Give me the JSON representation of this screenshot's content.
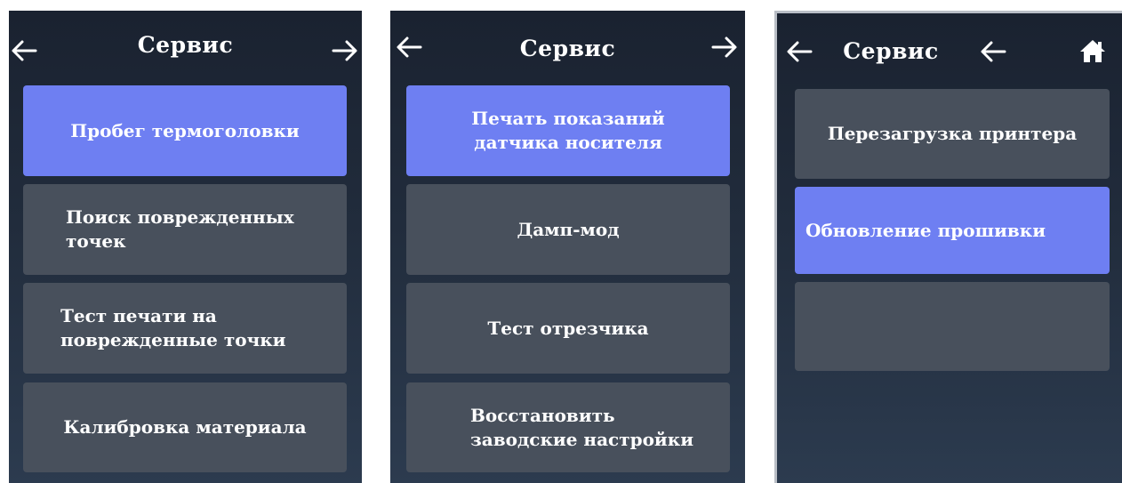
{
  "screens": [
    {
      "title": "Сервис",
      "items": [
        {
          "label": "Пробег термоголовки",
          "active": true
        },
        {
          "label": "Поиск поврежденных точек",
          "active": false
        },
        {
          "label": "Тест печати на поврежденные точки",
          "active": false
        },
        {
          "label": "Калибровка материала",
          "active": false
        }
      ]
    },
    {
      "title": "Сервис",
      "items": [
        {
          "label": "Печать показаний датчика носителя",
          "active": true
        },
        {
          "label": "Дамп-мод",
          "active": false
        },
        {
          "label": "Тест отрезчика",
          "active": false
        },
        {
          "label": "Восстановить заводские настройки",
          "active": false
        }
      ]
    },
    {
      "title": "Сервис",
      "items": [
        {
          "label": "Перезагрузка принтера",
          "active": false
        },
        {
          "label": "Обновление прошивки",
          "active": true
        },
        {
          "label": "",
          "active": false
        }
      ]
    }
  ],
  "icons": {
    "back": "left-arrow-icon",
    "forward": "right-arrow-icon",
    "home": "home-icon"
  },
  "colors": {
    "active_item": "#6e7ff2",
    "item": "#48505c",
    "background_top": "#1a2230",
    "background_bottom": "#2c3b4f",
    "text": "#ffffff"
  }
}
